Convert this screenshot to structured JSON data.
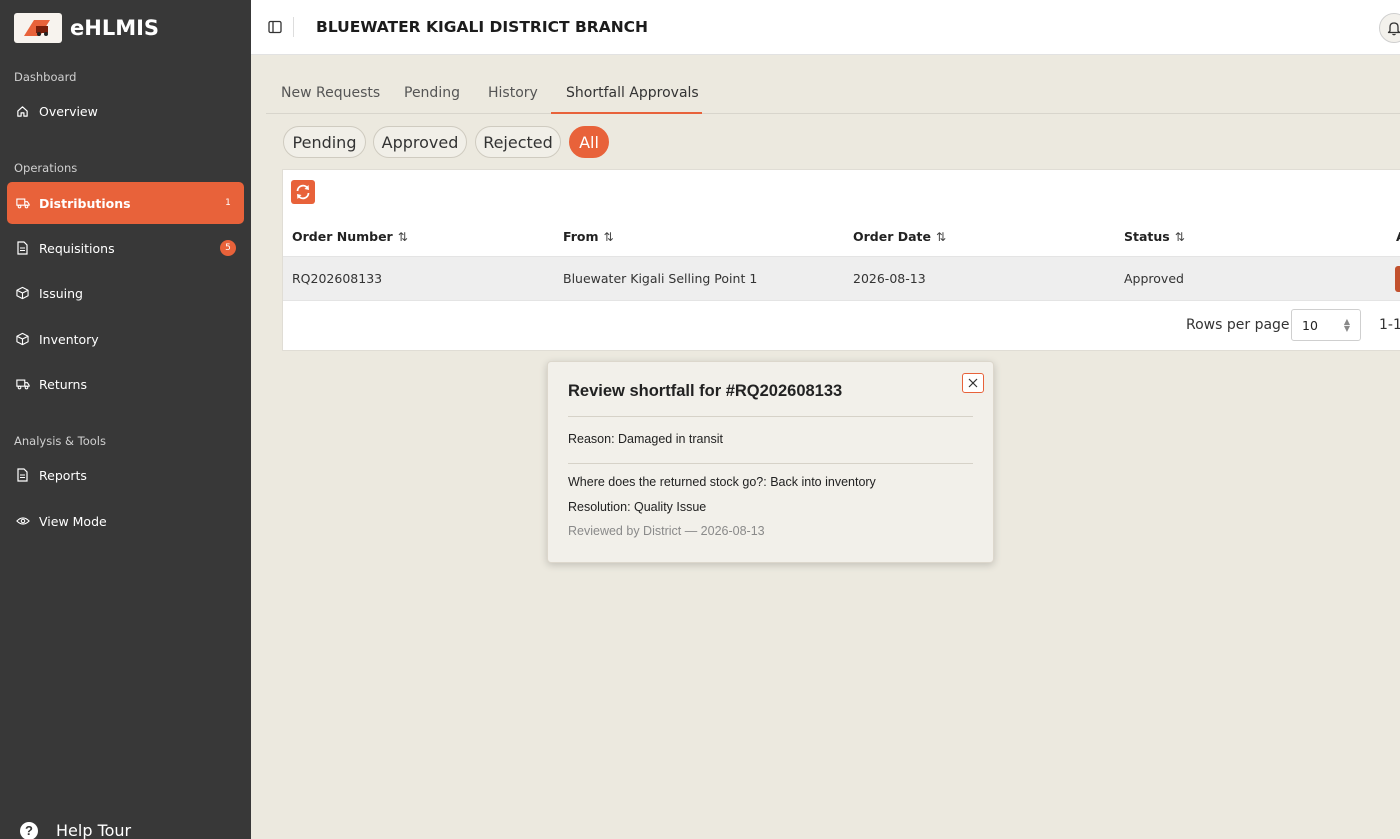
{
  "brand": {
    "name": "eHLMIS",
    "icon": "truck-logo"
  },
  "sidebar": {
    "sections": [
      {
        "label": "Dashboard"
      },
      {
        "label": "Operations"
      },
      {
        "label": "Analysis & Tools"
      }
    ],
    "items": [
      {
        "label": "Overview",
        "icon": "home-icon"
      },
      {
        "label": "Distributions",
        "icon": "truck-icon",
        "badge": "1",
        "active": true
      },
      {
        "label": "Requisitions",
        "icon": "document-icon",
        "badge": "5"
      },
      {
        "label": "Issuing",
        "icon": "box-icon"
      },
      {
        "label": "Inventory",
        "icon": "box-icon"
      },
      {
        "label": "Returns",
        "icon": "truck-icon"
      },
      {
        "label": "Reports",
        "icon": "document-icon"
      },
      {
        "label": "View Mode",
        "icon": "eye-icon"
      }
    ],
    "help_label": "Help Tour"
  },
  "header": {
    "title": "BLUEWATER KIGALI DISTRICT BRANCH"
  },
  "tabs": [
    {
      "label": "New Requests"
    },
    {
      "label": "Pending"
    },
    {
      "label": "History"
    },
    {
      "label": "Shortfall Approvals",
      "active": true
    }
  ],
  "filters": [
    {
      "label": "Pending"
    },
    {
      "label": "Approved"
    },
    {
      "label": "Rejected"
    },
    {
      "label": "All",
      "active": true
    }
  ],
  "table": {
    "columns": [
      "Order Number",
      "From",
      "Order Date",
      "Status",
      "A"
    ],
    "rows": [
      {
        "order_number": "RQ202608133",
        "from": "Bluewater Kigali Selling Point 1",
        "order_date": "2026-08-13",
        "status": "Approved"
      }
    ],
    "rows_per_page_label": "Rows per page",
    "rows_per_page_value": "10",
    "page_range": "1-1"
  },
  "modal": {
    "title": "Review shortfall for #RQ202608133",
    "reason": "Reason: Damaged in transit",
    "destination": "Where does the returned stock go?: Back into inventory",
    "resolution": "Resolution: Quality Issue",
    "reviewed": "Reviewed by District — 2026-08-13"
  },
  "colors": {
    "accent": "#e8623a",
    "sidebar": "#383838",
    "background": "#ece9df"
  }
}
